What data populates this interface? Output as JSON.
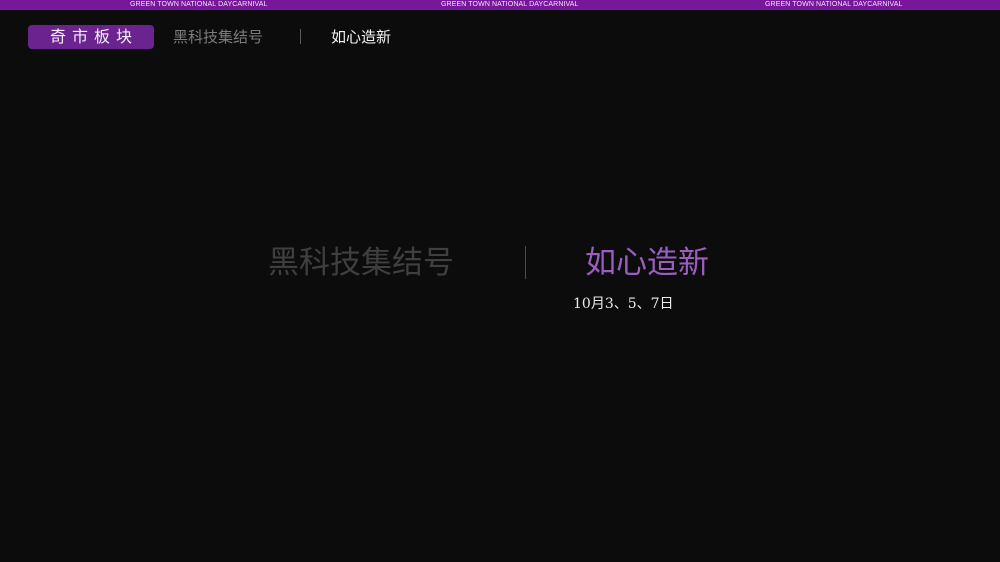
{
  "top_strip": {
    "repeats": [
      "GREEN TOWN   NATIONAL DAYCARNIVAL",
      "GREEN TOWN   NATIONAL DAYCARNIVAL",
      "GREEN TOWN   NATIONAL DAYCARNIVAL"
    ],
    "color": "#76179c"
  },
  "nav": {
    "badge_label": "奇市板块",
    "item_1": "黑科技集结号",
    "item_2": "如心造新"
  },
  "hero": {
    "left_text": "黑科技集结号",
    "right_text": "如心造新",
    "date": "10月3、5、7日",
    "accent_color": "#9b5dc0"
  }
}
